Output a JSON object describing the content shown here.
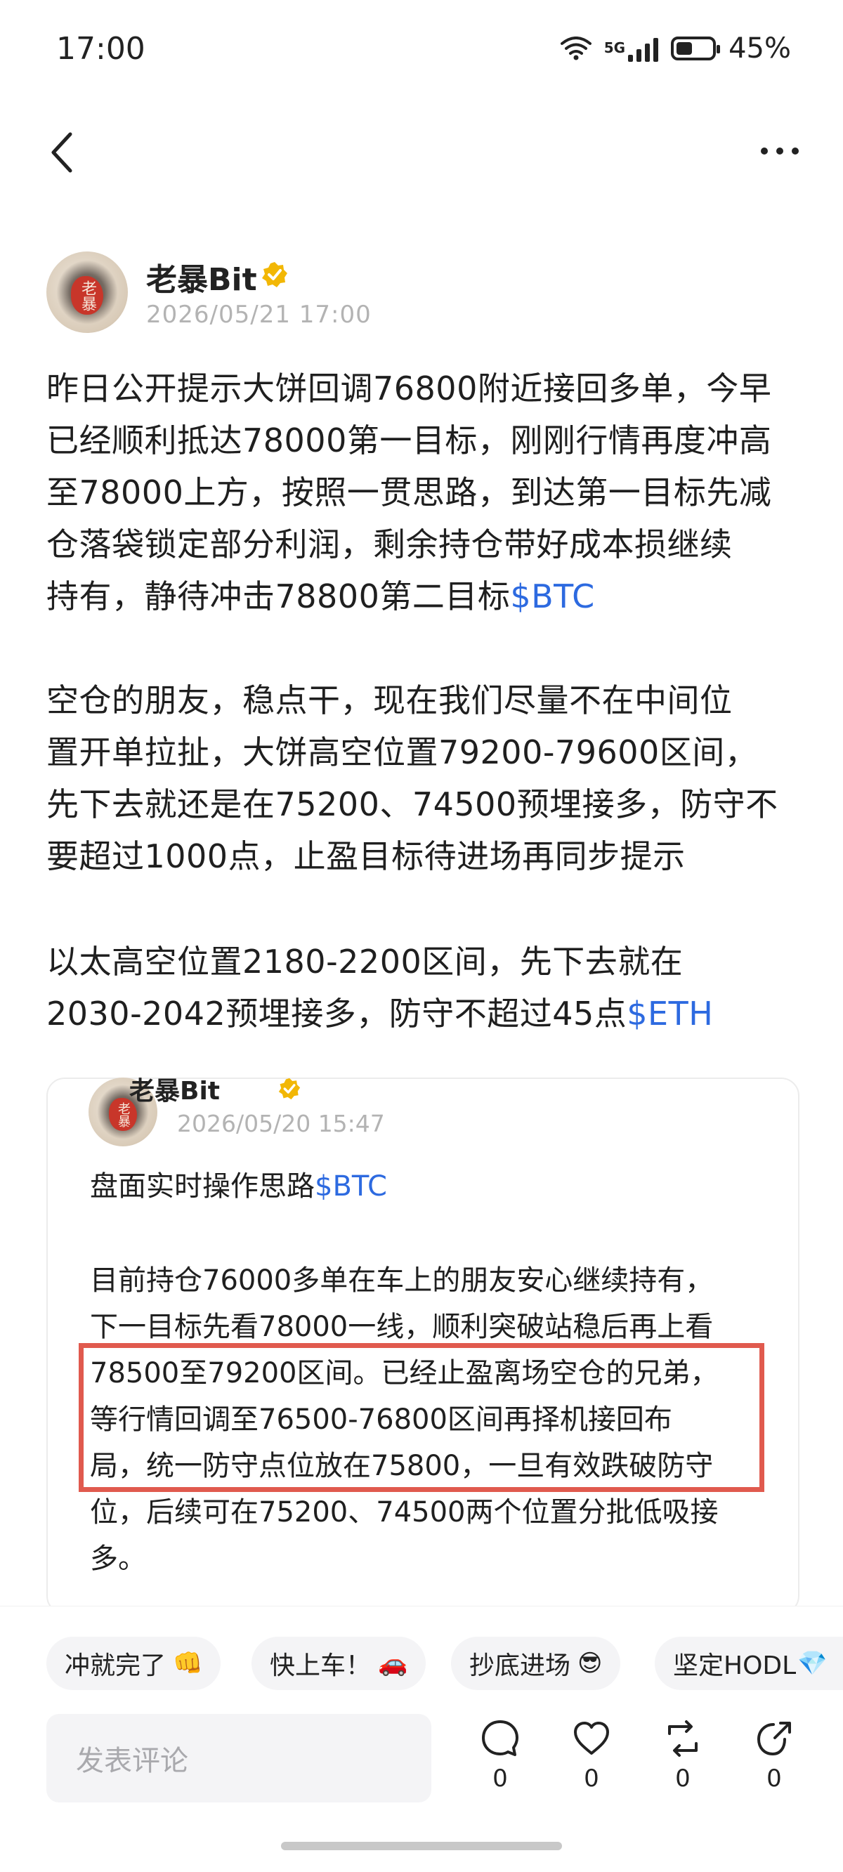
{
  "status_bar": {
    "time": "17:00",
    "network": "5G",
    "battery": "45%",
    "battery_level": 0.45
  },
  "post": {
    "author": "老暴Bit",
    "time": "2026/05/21 17:00",
    "paragraph1": [
      "昨日公开提示大饼回调76800附近接回多单，今早",
      "已经顺利抵达78000第一目标，刚刚行情再度冲高",
      "至78000上方，按照一贯思路，到达第一目标先减",
      "仓落袋锁定部分利润，剩余持仓带好成本损继续"
    ],
    "paragraph1_last": "持有，静待冲击78800第二目标",
    "tag_btc": "$BTC",
    "paragraph2": [
      "空仓的朋友，稳点干，现在我们尽量不在中间位",
      "置开单拉扯，大饼高空位置79200-79600区间，",
      "先下去就还是在75200、74500预埋接多，防守不",
      "要超过1000点，止盈目标待进场再同步提示"
    ],
    "paragraph3_line1": "以太高空位置2180-2200区间，先下去就在",
    "paragraph3_line2": "2030-2042预埋接多，防守不超过45点",
    "tag_eth": "$ETH"
  },
  "quote": {
    "author": "老暴Bit",
    "time": "2026/05/20 15:47",
    "title": "盘面实时操作思路",
    "tag_btc": "$BTC",
    "lines": [
      "目前持仓76000多单在车上的朋友安心继续持有，",
      "下一目标先看78000一线，顺利突破站稳后再上看",
      "78500至79200区间。已经止盈离场空仓的兄弟，",
      "等行情回调至76500-76800区间再择机接回布",
      "局，统一防守点位放在75800，一旦有效跌破防守",
      "位，后续可在75200、74500两个位置分批低吸接",
      "多。"
    ]
  },
  "reactions": [
    {
      "label": "冲就完了",
      "emoji": "👊"
    },
    {
      "label": "快上车！",
      "emoji": "🚗"
    },
    {
      "label": "抄底进场",
      "emoji": "😎"
    },
    {
      "label": "坚定HODL",
      "emoji": "💎"
    }
  ],
  "comment": {
    "placeholder": "发表评论"
  },
  "actions": {
    "comments": "0",
    "likes": "0",
    "reposts": "0",
    "shares": "0"
  },
  "colors": {
    "tag": "#2d6ae0",
    "highlight": "#e05a4e",
    "verified": "#f2b705"
  }
}
